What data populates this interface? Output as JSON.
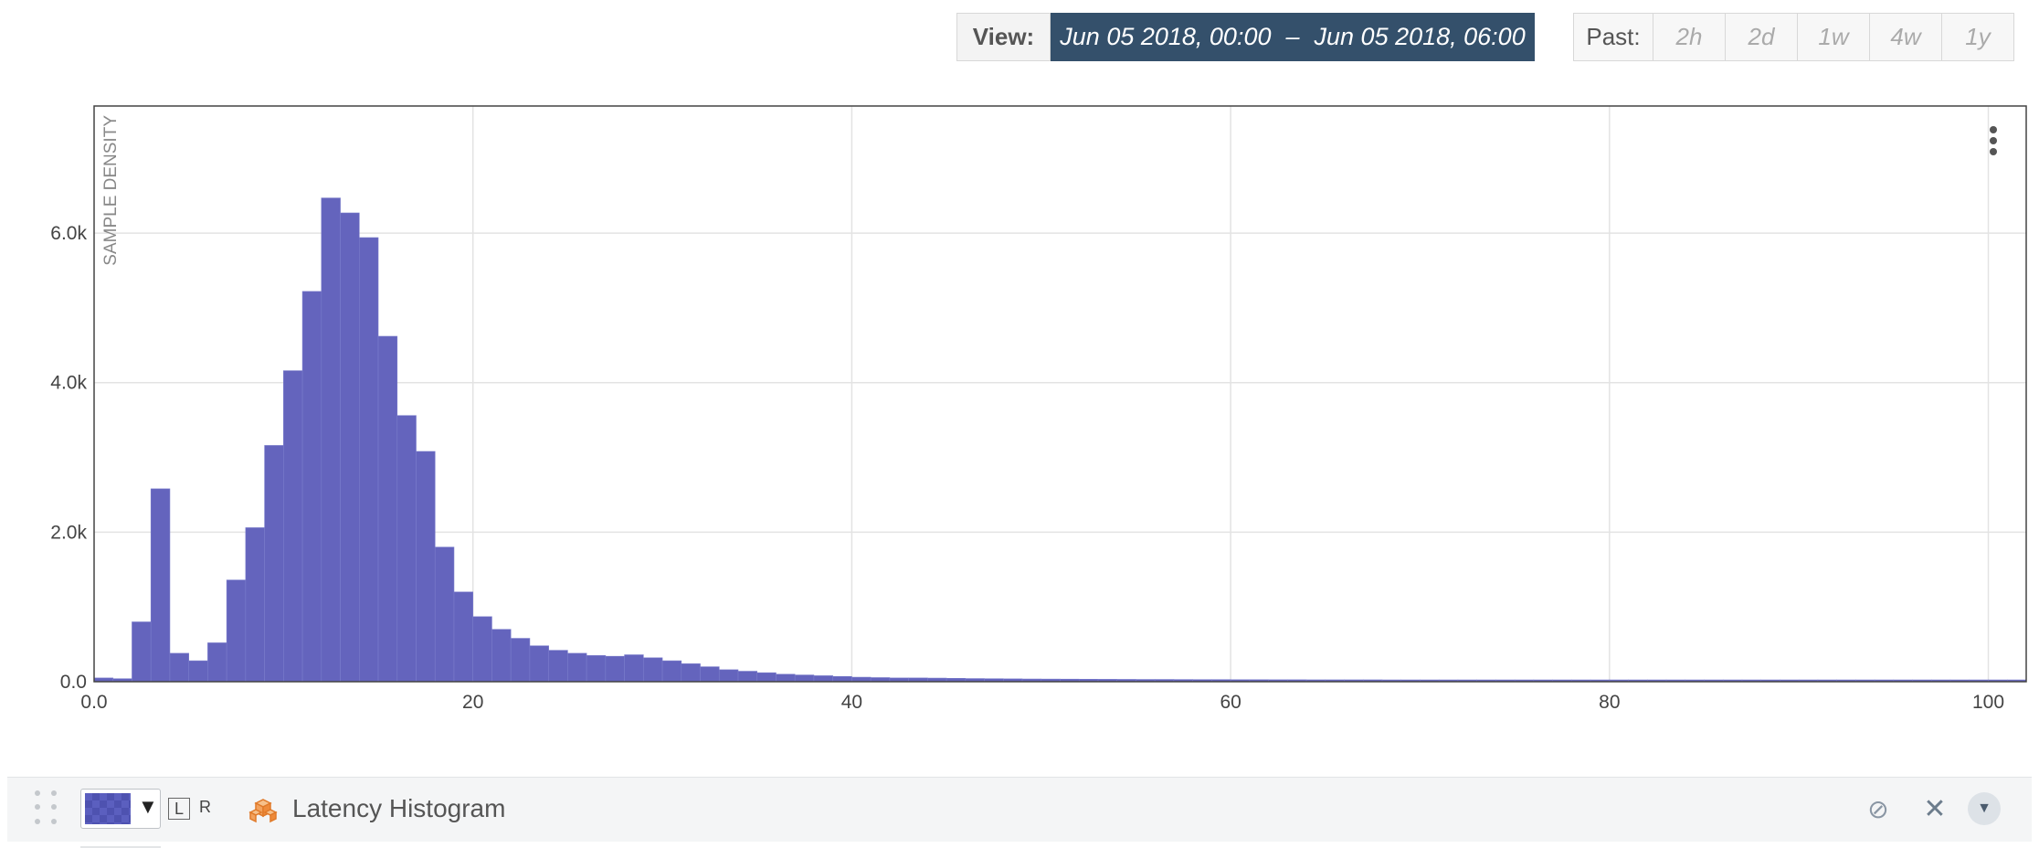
{
  "header": {
    "view_label": "View:",
    "range_start": "Jun 05 2018, 00:00",
    "range_sep": "–",
    "range_end": "Jun 05 2018, 06:00",
    "past_label": "Past:",
    "past_options": [
      "2h",
      "2d",
      "1w",
      "4w",
      "1y"
    ]
  },
  "legend": {
    "axis_left": "L",
    "axis_right": "R",
    "metric_name": "Latency Histogram",
    "series_color": "#5b5fbf",
    "icons": [
      "drag-handle-icon",
      "color-swatch",
      "metric-cube-icon",
      "disable-icon",
      "close-icon",
      "chevron-down-icon"
    ]
  },
  "chart_data": {
    "type": "bar",
    "ylabel": "SAMPLE DENSITY",
    "xlabel": "",
    "xlim": [
      0,
      102
    ],
    "ylim": [
      0,
      7700
    ],
    "xticks": [
      0,
      20,
      40,
      60,
      80,
      100
    ],
    "xtick_labels": [
      "0.0",
      "20",
      "40",
      "60",
      "80",
      "100"
    ],
    "yticks": [
      0,
      2000,
      4000,
      6000
    ],
    "ytick_labels": [
      "0.0",
      "2.0k",
      "4.0k",
      "6.0k"
    ],
    "grid": true,
    "bar_color": "#6464bd",
    "bin_width": 1,
    "bin_start": 0,
    "values": [
      50,
      40,
      800,
      2580,
      380,
      280,
      520,
      1360,
      2060,
      3160,
      4160,
      5220,
      6470,
      6270,
      5940,
      4620,
      3560,
      3080,
      1800,
      1200,
      870,
      700,
      580,
      480,
      420,
      380,
      350,
      340,
      360,
      320,
      280,
      240,
      200,
      160,
      140,
      120,
      100,
      90,
      80,
      70,
      60,
      55,
      50,
      50,
      48,
      45,
      42,
      40,
      38,
      36,
      35,
      34,
      33,
      32,
      31,
      30,
      30,
      29,
      28,
      28,
      27,
      27,
      26,
      26,
      25,
      25,
      25,
      25,
      24,
      24,
      24,
      24,
      24,
      24,
      24,
      24,
      24,
      24,
      24,
      24,
      24,
      24,
      24,
      24,
      24,
      24,
      24,
      24,
      24,
      24,
      24,
      24,
      24,
      24,
      24,
      24,
      24,
      24,
      24,
      24,
      24,
      24
    ]
  }
}
